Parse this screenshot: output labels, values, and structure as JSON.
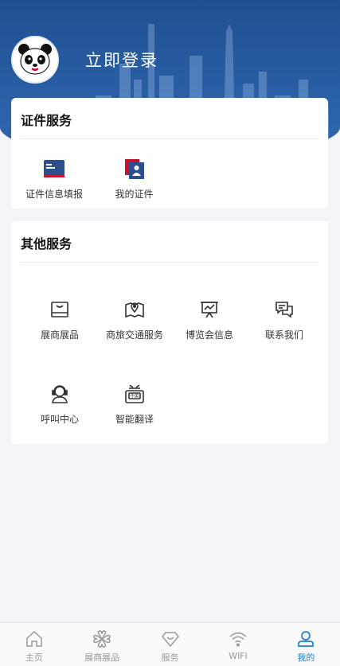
{
  "header": {
    "login_text": "立即登录"
  },
  "cert_services": {
    "title": "证件服务",
    "items": [
      {
        "label": "证件信息填报",
        "icon": "id-form-icon"
      },
      {
        "label": "我的证件",
        "icon": "my-certificate-icon"
      }
    ]
  },
  "other_services": {
    "title": "其他服务",
    "items": [
      {
        "label": "展商展品",
        "icon": "exhibit-box-icon"
      },
      {
        "label": "商旅交通服务",
        "icon": "map-pin-icon"
      },
      {
        "label": "博览会信息",
        "icon": "presentation-board-icon"
      },
      {
        "label": "联系我们",
        "icon": "chat-bubbles-icon"
      },
      {
        "label": "呼叫中心",
        "icon": "call-center-icon"
      },
      {
        "label": "智能翻译",
        "icon": "translator-device-icon"
      }
    ],
    "translator_badge": "中英"
  },
  "tabbar": {
    "items": [
      {
        "label": "主页",
        "icon": "home-icon"
      },
      {
        "label": "展商展品",
        "icon": "clover-icon"
      },
      {
        "label": "服务",
        "icon": "diamond-icon"
      },
      {
        "label": "WIFI",
        "icon": "wifi-icon"
      },
      {
        "label": "我的",
        "icon": "user-icon",
        "active": true
      }
    ]
  },
  "colors": {
    "header_blue": "#2a5fa6",
    "accent": "#1b7fd6",
    "cert_red": "#c8102e"
  }
}
